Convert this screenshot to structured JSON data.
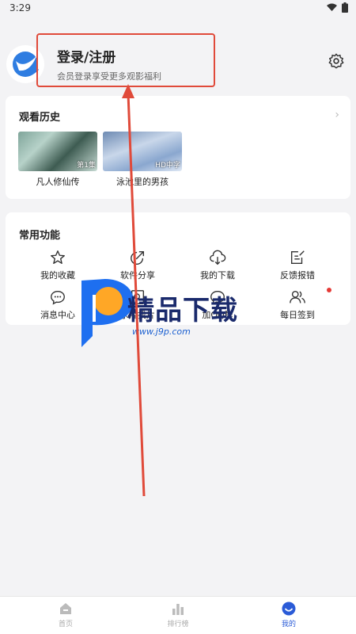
{
  "status_bar": {
    "time": "3:29"
  },
  "profile": {
    "login_title": "登录/注册",
    "login_subtitle": "会员登录享受更多观影福利"
  },
  "history": {
    "title": "观看历史",
    "items": [
      {
        "title": "凡人修仙传",
        "badge": "第1集"
      },
      {
        "title": "泳池里的男孩",
        "badge": "HD中字"
      }
    ]
  },
  "functions": {
    "title": "常用功能",
    "items": [
      {
        "label": "我的收藏",
        "icon": "star-icon"
      },
      {
        "label": "软件分享",
        "icon": "share-icon"
      },
      {
        "label": "我的下载",
        "icon": "cloud-download-icon"
      },
      {
        "label": "反馈报错",
        "icon": "feedback-icon"
      },
      {
        "label": "消息中心",
        "icon": "message-icon"
      },
      {
        "label": "求片找片",
        "icon": "request-icon"
      },
      {
        "label": "加QQ群",
        "icon": "qq-group-icon"
      },
      {
        "label": "每日签到",
        "icon": "signin-icon"
      }
    ]
  },
  "watermark": {
    "name": "精品下载",
    "url": "www.j9p.com"
  },
  "tabbar": {
    "items": [
      {
        "label": "首页",
        "icon": "home-icon",
        "active": false
      },
      {
        "label": "排行榜",
        "icon": "ranking-icon",
        "active": false
      },
      {
        "label": "我的",
        "icon": "profile-icon",
        "active": true
      }
    ]
  },
  "colors": {
    "accent": "#2a5bd7",
    "highlight_box": "#e04a3a",
    "notification_dot": "#e53935"
  }
}
